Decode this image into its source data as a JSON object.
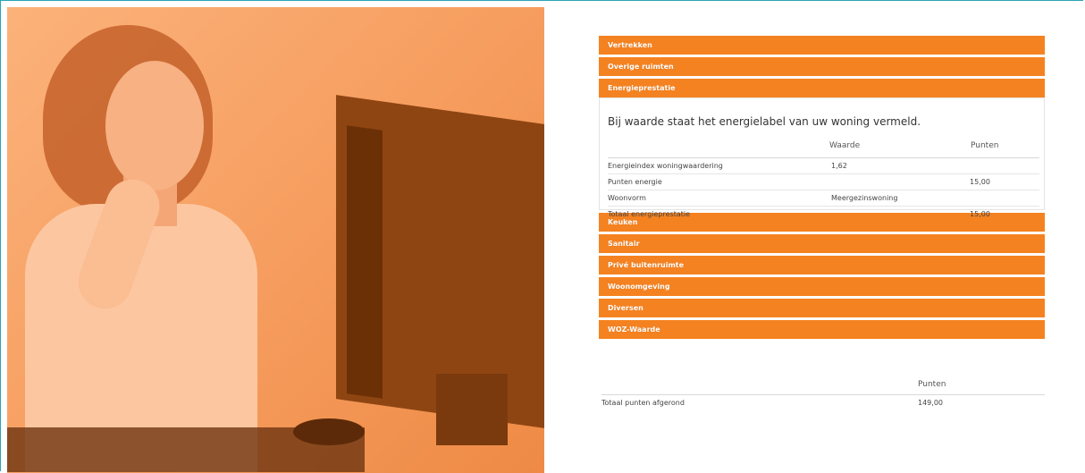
{
  "sections_top": [
    {
      "label": "Vertrekken"
    },
    {
      "label": "Overige ruimten"
    },
    {
      "label": "Energieprestatie"
    }
  ],
  "energy_panel": {
    "title": "Bij waarde staat het energielabel van uw woning vermeld.",
    "columns": {
      "name": "",
      "waarde": "Waarde",
      "punten": "Punten"
    },
    "rows": [
      {
        "name": "Energieindex woningwaardering",
        "waarde": "1,62",
        "punten": ""
      },
      {
        "name": "Punten energie",
        "waarde": "",
        "punten": "15,00"
      },
      {
        "name": "Woonvorm",
        "waarde": "Meergezinswoning",
        "punten": ""
      },
      {
        "name": "Totaal energieprestatie",
        "waarde": "",
        "punten": "15,00"
      }
    ]
  },
  "sections_bottom": [
    {
      "label": "Keuken"
    },
    {
      "label": "Sanitair"
    },
    {
      "label": "Privé buitenruimte"
    },
    {
      "label": "Woonomgeving"
    },
    {
      "label": "Diversen"
    },
    {
      "label": "WOZ-Waarde"
    }
  ],
  "totals": {
    "column_punten": "Punten",
    "label": "Totaal punten afgerond",
    "value": "149,00"
  },
  "colors": {
    "accent": "#f58220",
    "border_frame": "#2aa4b7"
  }
}
